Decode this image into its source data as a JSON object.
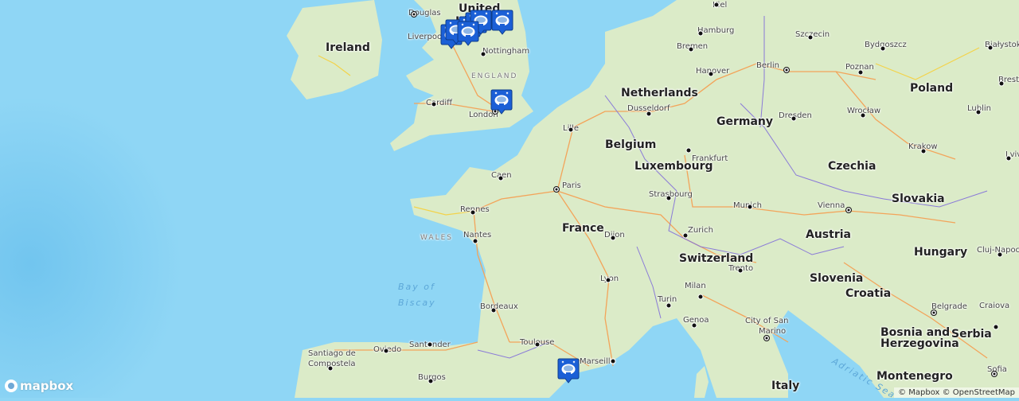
{
  "map": {
    "colors": {
      "ocean": "#8fd6f5",
      "deep_ocean": "#6ec3ee",
      "land": "#dbebc8",
      "road_major": "#f3a45a",
      "road_minor": "#f3d34a",
      "border": "#8a7ad8",
      "marker": "#1b5fd6"
    },
    "countries": [
      {
        "name": "Ireland"
      },
      {
        "name": "Netherlands"
      },
      {
        "name": "Germany"
      },
      {
        "name": "Poland"
      },
      {
        "name": "Belgium"
      },
      {
        "name": "Luxembourg"
      },
      {
        "name": "Czechia"
      },
      {
        "name": "Slovakia"
      },
      {
        "name": "France"
      },
      {
        "name": "Austria"
      },
      {
        "name": "Hungary"
      },
      {
        "name": "Switzerland"
      },
      {
        "name": "Slovenia"
      },
      {
        "name": "Croatia"
      },
      {
        "name": "Italy"
      },
      {
        "name": "Serbia"
      },
      {
        "name": "Bosnia and"
      },
      {
        "name": "Herzegovina"
      },
      {
        "name": "Montenegro"
      },
      {
        "name": "United"
      },
      {
        "name": "Kingdom"
      }
    ],
    "regions": [
      {
        "name": "WALES"
      },
      {
        "name": "ENGLAND"
      }
    ],
    "waters": [
      {
        "name": "Bay of"
      },
      {
        "name": "Biscay"
      },
      {
        "name": "Adriatic Sea"
      }
    ],
    "cities": [
      {
        "name": "Douglas",
        "capital": true
      },
      {
        "name": "Liverpool",
        "capital": false
      },
      {
        "name": "Nottingham",
        "capital": false
      },
      {
        "name": "Cardiff",
        "capital": false
      },
      {
        "name": "London",
        "capital": true
      },
      {
        "name": "Kiel",
        "capital": false
      },
      {
        "name": "Hamburg",
        "capital": false
      },
      {
        "name": "Bremen",
        "capital": false
      },
      {
        "name": "Hanover",
        "capital": false
      },
      {
        "name": "Berlin",
        "capital": true
      },
      {
        "name": "Szczecin",
        "capital": false
      },
      {
        "name": "Bydgoszcz",
        "capital": false
      },
      {
        "name": "Białystok",
        "capital": false
      },
      {
        "name": "Poznan",
        "capital": false
      },
      {
        "name": "Brest",
        "capital": false
      },
      {
        "name": "Dusseldorf",
        "capital": false
      },
      {
        "name": "Dresden",
        "capital": false
      },
      {
        "name": "Wrocław",
        "capital": false
      },
      {
        "name": "Lublin",
        "capital": false
      },
      {
        "name": "Lille",
        "capital": false
      },
      {
        "name": "Krakow",
        "capital": false
      },
      {
        "name": "Lviv",
        "capital": false
      },
      {
        "name": "Frankfurt",
        "capital": false
      },
      {
        "name": "Caen",
        "capital": false
      },
      {
        "name": "Paris",
        "capital": true
      },
      {
        "name": "Strasbourg",
        "capital": false
      },
      {
        "name": "Rennes",
        "capital": false
      },
      {
        "name": "Munich",
        "capital": false
      },
      {
        "name": "Vienna",
        "capital": true
      },
      {
        "name": "Nantes",
        "capital": false
      },
      {
        "name": "Dijon",
        "capital": false
      },
      {
        "name": "Zurich",
        "capital": false
      },
      {
        "name": "Cluj-Napoca",
        "capital": false
      },
      {
        "name": "Trento",
        "capital": false
      },
      {
        "name": "Lyon",
        "capital": false
      },
      {
        "name": "Milan",
        "capital": false
      },
      {
        "name": "Bordeaux",
        "capital": false
      },
      {
        "name": "Turin",
        "capital": false
      },
      {
        "name": "Genoa",
        "capital": false
      },
      {
        "name": "City of San",
        "capital": false
      },
      {
        "name": "Marino",
        "capital": true
      },
      {
        "name": "Belgrade",
        "capital": true
      },
      {
        "name": "Craiova",
        "capital": false
      },
      {
        "name": "Santiago de",
        "capital": false
      },
      {
        "name": "Compostela",
        "capital": false
      },
      {
        "name": "Oviedo",
        "capital": false
      },
      {
        "name": "Santander",
        "capital": false
      },
      {
        "name": "Toulouse",
        "capital": false
      },
      {
        "name": "Burgos",
        "capital": false
      },
      {
        "name": "Marseille",
        "capital": false
      },
      {
        "name": "Sofia",
        "capital": true
      }
    ],
    "markers": [
      {
        "name": "stadium-marker",
        "icon": "stadium-icon"
      },
      {
        "name": "stadium-marker",
        "icon": "stadium-icon"
      },
      {
        "name": "stadium-marker",
        "icon": "stadium-icon"
      },
      {
        "name": "stadium-marker",
        "icon": "stadium-icon"
      },
      {
        "name": "stadium-marker",
        "icon": "stadium-icon"
      },
      {
        "name": "stadium-marker",
        "icon": "stadium-icon"
      },
      {
        "name": "stadium-marker",
        "icon": "stadium-icon"
      },
      {
        "name": "stadium-marker",
        "icon": "stadium-icon"
      },
      {
        "name": "stadium-marker",
        "icon": "stadium-icon"
      }
    ]
  },
  "logo": {
    "text": "mapbox"
  },
  "attribution": {
    "mapbox": "© Mapbox",
    "osm": "© OpenStreetMap"
  }
}
